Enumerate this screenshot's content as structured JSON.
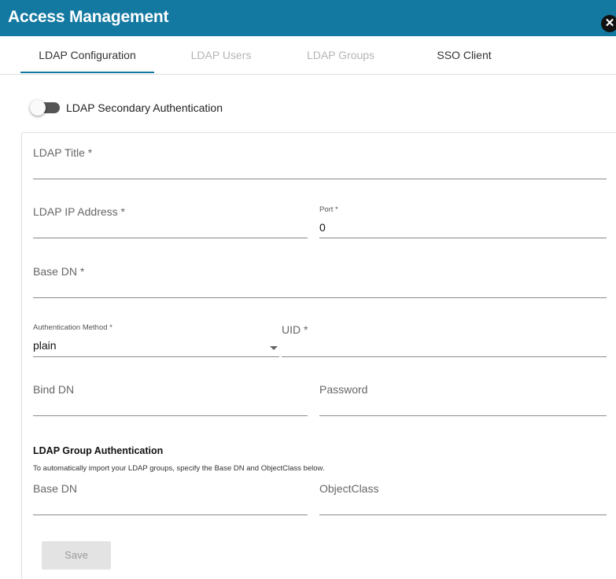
{
  "window": {
    "title": "Access Management",
    "close_icon": "close-icon",
    "accent_color": "#1479a1"
  },
  "tabs": [
    {
      "label": "LDAP Configuration",
      "state": "active"
    },
    {
      "label": "LDAP Users",
      "state": "disabled"
    },
    {
      "label": "LDAP Groups",
      "state": "disabled"
    },
    {
      "label": "SSO Client",
      "state": "normal"
    }
  ],
  "secondary_auth": {
    "label": "LDAP Secondary Authentication",
    "enabled": false
  },
  "form": {
    "ldap_title": {
      "placeholder": "LDAP Title *",
      "value": ""
    },
    "ldap_ip": {
      "placeholder": "LDAP IP Address *",
      "value": ""
    },
    "port": {
      "label": "Port *",
      "value": "0"
    },
    "base_dn": {
      "placeholder": "Base DN *",
      "value": ""
    },
    "auth_method": {
      "label": "Authentication Method *",
      "value": "plain"
    },
    "uid": {
      "placeholder": "UID *",
      "value": ""
    },
    "bind_dn": {
      "placeholder": "Bind DN",
      "value": ""
    },
    "password": {
      "placeholder": "Password",
      "value": ""
    }
  },
  "group_auth": {
    "title": "LDAP Group Authentication",
    "description": "To automatically import your LDAP groups, specify the Base DN and ObjectClass below.",
    "base_dn": {
      "placeholder": "Base DN",
      "value": ""
    },
    "object_class": {
      "placeholder": "ObjectClass",
      "value": ""
    }
  },
  "actions": {
    "save_label": "Save"
  }
}
